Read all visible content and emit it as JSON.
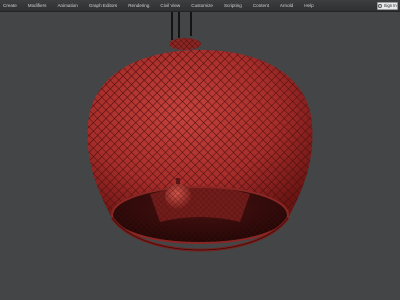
{
  "menubar": {
    "items": [
      {
        "label": "Create"
      },
      {
        "label": "Modifiers"
      },
      {
        "label": "Animation"
      },
      {
        "label": "Graph Editors"
      },
      {
        "label": "Rendering"
      },
      {
        "label": "Civil View"
      },
      {
        "label": "Customize"
      },
      {
        "label": "Scripting"
      },
      {
        "label": "Content"
      },
      {
        "label": "Arnold"
      },
      {
        "label": "Help"
      }
    ],
    "sign_in_label": "Sign In",
    "sign_in_icon": "user-icon"
  },
  "viewport": {
    "background_color": "#444547",
    "model_color": "#b0322f",
    "wire_color": "#4a0e0d",
    "cord_color": "#141414"
  }
}
